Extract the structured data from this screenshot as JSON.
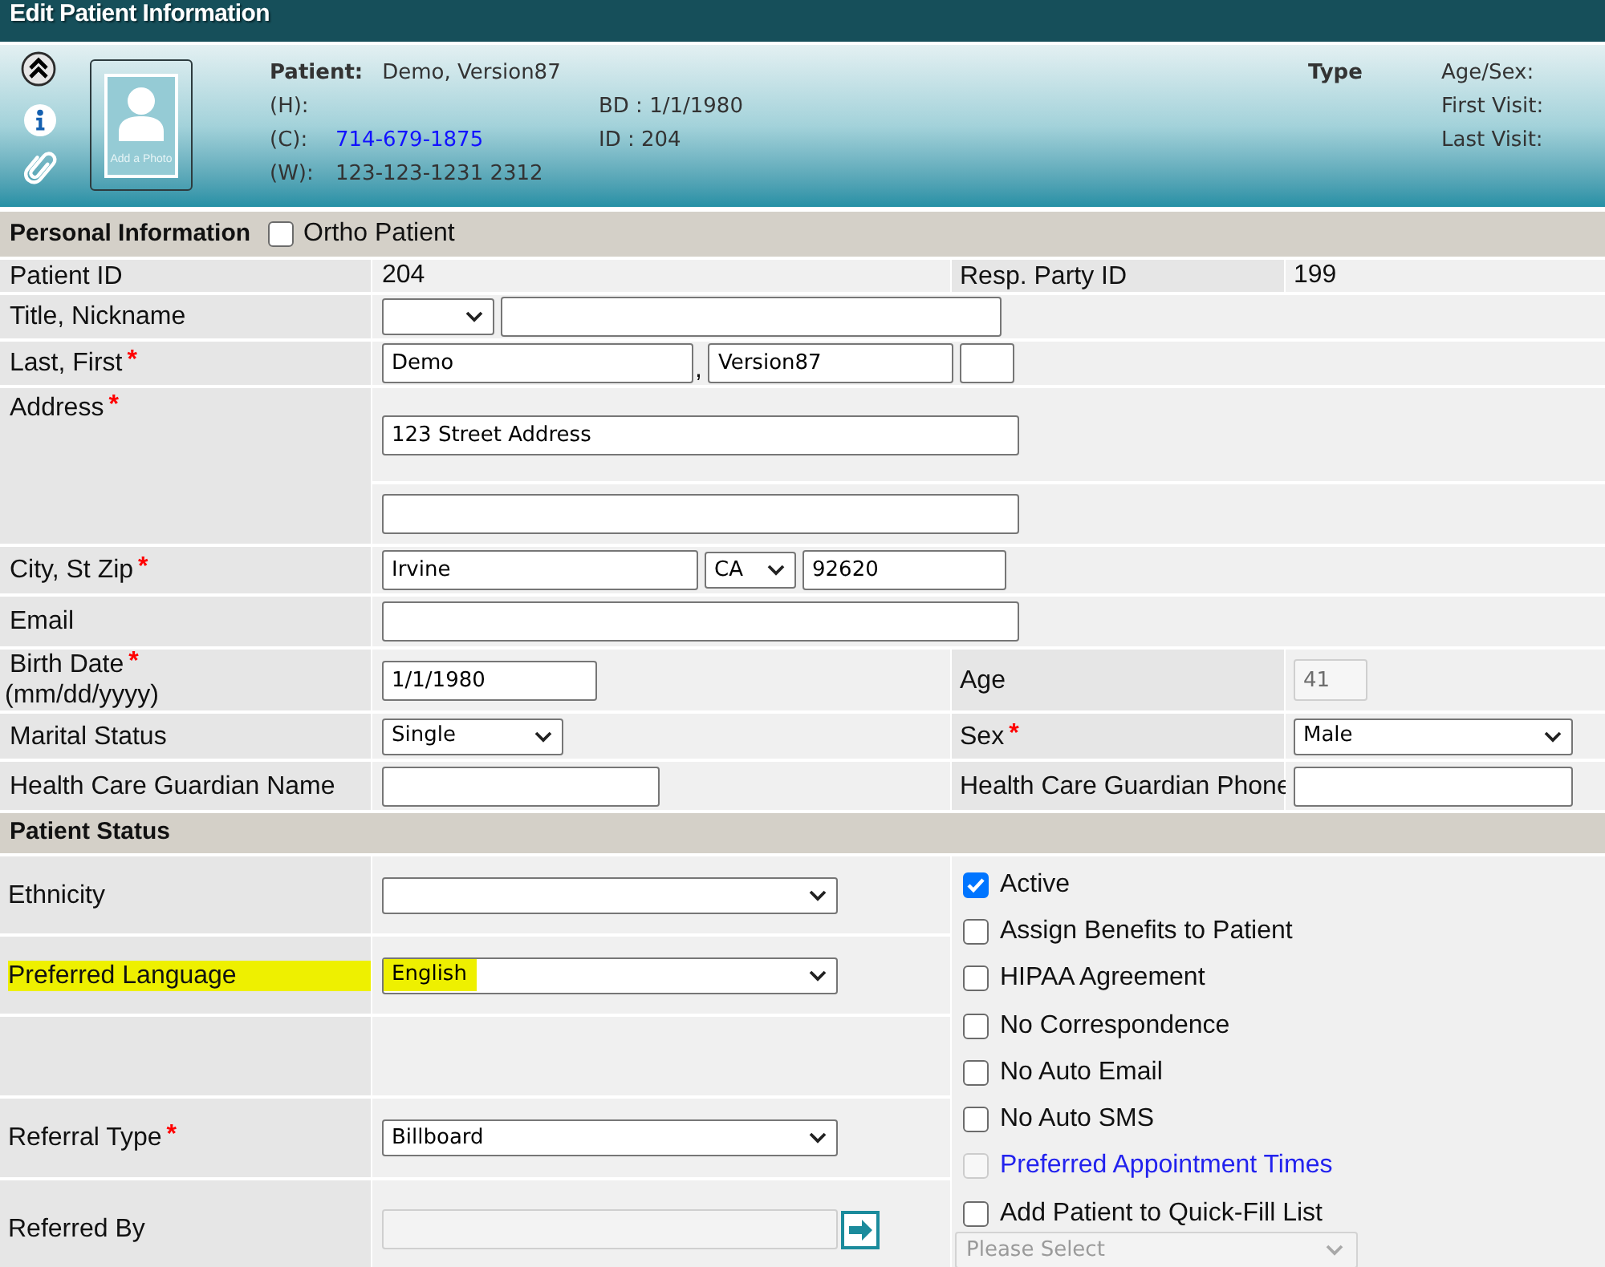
{
  "window": {
    "title": "Edit Patient Information"
  },
  "patient_header": {
    "photo_caption": "Add a Photo",
    "patient_label": "Patient:",
    "patient_name": "Demo, Version87",
    "phones": [
      {
        "label": "(H):"
      },
      {
        "label": "(C):",
        "value": "714-679-1875",
        "kind": "link"
      },
      {
        "label": "(W):",
        "value": "123-123-1231 2312",
        "kind": "text"
      }
    ],
    "details": [
      "BD : 1/1/1980",
      "ID : 204"
    ],
    "type_label": "Type",
    "visit_labels": [
      "Age/Sex:",
      "First Visit:",
      "Last Visit:"
    ]
  },
  "personal_information": {
    "title": "Personal Information",
    "ortho_patient": {
      "label": "Ortho Patient",
      "checked": false
    },
    "rows": [
      {
        "kind": "inline",
        "items": [
          {
            "label": "Patient ID",
            "fields": [
              {
                "kind": "text",
                "value": "204"
              }
            ]
          },
          {
            "label": "Resp. Party ID",
            "fields": [
              {
                "kind": "text",
                "value": "199"
              }
            ]
          }
        ]
      },
      {
        "kind": "inline",
        "items": [
          {
            "label": "Title, Nickname",
            "fields": [
              {
                "kind": "select"
              },
              {
                "kind": "input"
              }
            ]
          }
        ]
      },
      {
        "kind": "inline",
        "items": [
          {
            "label": "Last, First",
            "required_mark": "*",
            "fields": [
              {
                "kind": "input",
                "value": "Demo"
              },
              {
                "kind": "separator",
                "value": ","
              },
              {
                "kind": "input",
                "value": "Version87"
              },
              {
                "kind": "input"
              }
            ]
          }
        ]
      },
      {
        "kind": "stacked",
        "items": [
          {
            "label": "Address",
            "required_mark": "*",
            "fields": [
              {
                "kind": "input",
                "value": "123 Street Address"
              },
              {
                "kind": "input"
              }
            ]
          }
        ]
      },
      {
        "kind": "inline",
        "items": [
          {
            "label": "City, St Zip",
            "required_mark": "*",
            "fields": [
              {
                "kind": "input",
                "value": "Irvine"
              },
              {
                "kind": "select",
                "value": "CA"
              },
              {
                "kind": "input",
                "value": "92620"
              }
            ]
          }
        ]
      },
      {
        "kind": "inline",
        "items": [
          {
            "label": "Email",
            "fields": [
              {
                "kind": "input"
              }
            ]
          }
        ]
      },
      {
        "kind": "inline",
        "items": [
          {
            "label": "Birth Date",
            "required_mark": "*",
            "sublabel": "(mm/dd/yyyy)",
            "fields": [
              {
                "kind": "input",
                "value": "1/1/1980"
              }
            ]
          },
          {
            "label": "Age",
            "fields": [
              {
                "kind": "readonly",
                "value": "41"
              }
            ]
          }
        ]
      },
      {
        "kind": "inline",
        "items": [
          {
            "label": "Marital Status",
            "fields": [
              {
                "kind": "select",
                "value": "Single"
              }
            ]
          },
          {
            "label": "Sex",
            "required_mark": "*",
            "fields": [
              {
                "kind": "select",
                "value": "Male"
              }
            ]
          }
        ]
      },
      {
        "kind": "inline",
        "items": [
          {
            "label": "Health Care Guardian Name",
            "fields": [
              {
                "kind": "input"
              }
            ]
          },
          {
            "label": "Health Care Guardian Phone",
            "fields": [
              {
                "kind": "input"
              }
            ]
          }
        ]
      }
    ]
  },
  "patient_status": {
    "title": "Patient Status",
    "rows": [
      {
        "kind": "field",
        "label": "Ethnicity",
        "highlighted": false,
        "fields": [
          {
            "kind": "select"
          }
        ]
      },
      {
        "kind": "field",
        "label": "Preferred Language",
        "highlighted": true,
        "fields": [
          {
            "kind": "select",
            "value": "English"
          }
        ]
      },
      {
        "kind": "blank"
      },
      {
        "kind": "field",
        "label": "Referral Type",
        "required_mark": "*",
        "highlighted": false,
        "fields": [
          {
            "kind": "select",
            "value": "Billboard"
          }
        ]
      },
      {
        "kind": "field",
        "label": "Referred By",
        "highlighted": false,
        "fields": [
          {
            "kind": "disabled_input"
          },
          {
            "kind": "go_button"
          }
        ]
      }
    ],
    "options": [
      {
        "label": "Active",
        "kind": "text",
        "checked": true,
        "disabled": false
      },
      {
        "label": "Assign Benefits to Patient",
        "kind": "text",
        "checked": false,
        "disabled": false
      },
      {
        "label": "HIPAA Agreement",
        "kind": "text",
        "checked": false,
        "disabled": false
      },
      {
        "label": "No Correspondence",
        "kind": "text",
        "checked": false,
        "disabled": false
      },
      {
        "label": "No Auto Email",
        "kind": "text",
        "checked": false,
        "disabled": false
      },
      {
        "label": "No Auto SMS",
        "kind": "text",
        "checked": false,
        "disabled": false
      },
      {
        "label": "Preferred Appointment Times",
        "kind": "link",
        "checked": false,
        "disabled": true
      },
      {
        "label": "Add Patient to Quick-Fill List",
        "kind": "text",
        "checked": false,
        "disabled": false
      }
    ],
    "quick_fill_list": {
      "value": "Please Select",
      "disabled": true
    }
  }
}
